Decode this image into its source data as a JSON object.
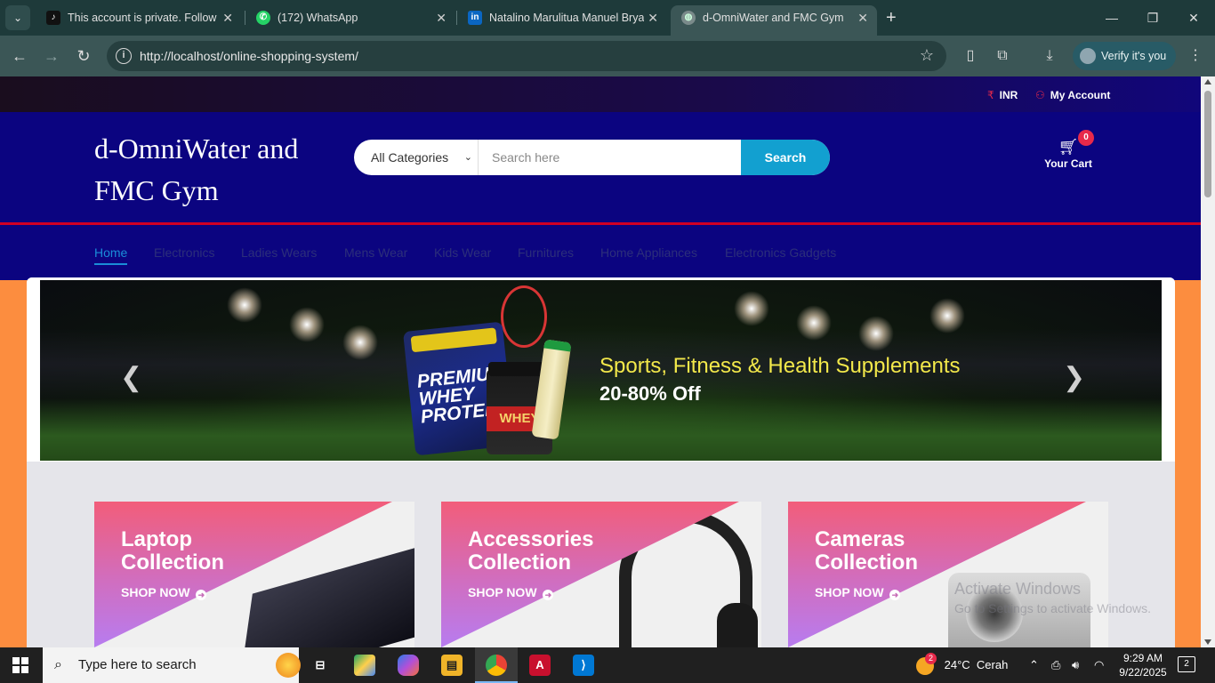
{
  "browser": {
    "tabs": [
      {
        "title": "This account is private. Follow t",
        "icon": "tiktok-icon",
        "active": false
      },
      {
        "title": "(172) WhatsApp",
        "icon": "whatsapp-icon",
        "active": false
      },
      {
        "title": "Natalino Marulitua Manuel Brya",
        "icon": "linkedin-icon",
        "active": false
      },
      {
        "title": "d-OmniWater and FMC Gym",
        "icon": "globe-icon",
        "active": true
      }
    ],
    "url": "http://localhost/online-shopping-system/",
    "verify_label": "Verify it's you"
  },
  "site": {
    "topbar": {
      "currency": "INR",
      "account": "My Account"
    },
    "logo": "d-OmniWater and FMC Gym",
    "search": {
      "category": "All Categories",
      "placeholder": "Search here",
      "button": "Search"
    },
    "cart": {
      "count": "0",
      "label": "Your Cart"
    },
    "nav": [
      "Home",
      "Electronics",
      "Ladies Wears",
      "Mens Wear",
      "Kids Wear",
      "Furnitures",
      "Home Appliances",
      "Electronics Gadgets"
    ],
    "slider": {
      "title": "Sports, Fitness & Health Supplements",
      "subtitle": "20-80% Off",
      "product_tub_text": "PREMIUM WHEY PROTEIN",
      "product_jar_text": "WHEY"
    },
    "collections": [
      {
        "title_line1": "Laptop",
        "title_line2": "Collection",
        "link": "SHOP NOW"
      },
      {
        "title_line1": "Accessories",
        "title_line2": "Collection",
        "link": "SHOP NOW"
      },
      {
        "title_line1": "Cameras",
        "title_line2": "Collection",
        "link": "SHOP NOW"
      }
    ],
    "watermark": {
      "line1": "Activate Windows",
      "line2": "Go to Settings to activate Windows."
    }
  },
  "taskbar": {
    "search_placeholder": "Type here to search",
    "weather_badge": "2",
    "weather": "24°C  Cerah",
    "time": "9:29 AM",
    "date": "9/22/2025",
    "notifications": "2"
  },
  "colors": {
    "header_bg": "#0b0480",
    "accent_red": "#d10024",
    "search_btn": "#12a0d0",
    "page_bg": "#fc8d3f",
    "nav_active": "#1a8dd8"
  }
}
